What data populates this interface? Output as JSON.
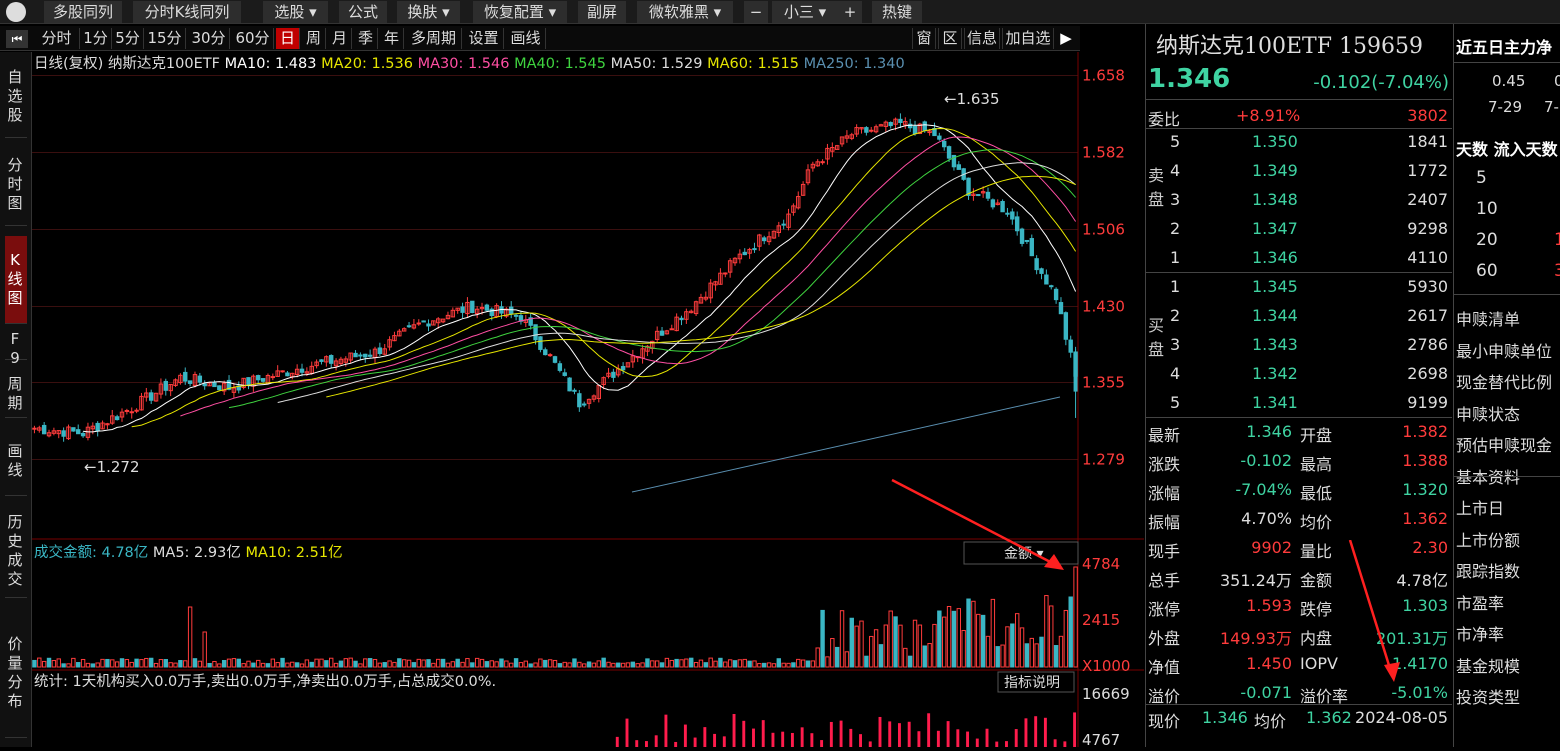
{
  "topbar": [
    "多股同列",
    "分时K线同列",
    "选股",
    "公式",
    "换肤",
    "恢复配置",
    "副屏",
    "微软雅黑",
    "−",
    "小三",
    "+",
    "热键"
  ],
  "periods": [
    "分时",
    "1分",
    "5分",
    "15分",
    "30分",
    "60分",
    "日",
    "周",
    "月",
    "季",
    "年",
    "多周期",
    "设置",
    "画线"
  ],
  "right_tools": [
    "窗",
    "区",
    "信息",
    "加自选"
  ],
  "sidebar": [
    "自选股",
    "分时图",
    "K线图",
    "F9",
    "周期",
    "画线",
    "历史成交",
    "价量分布"
  ],
  "legend": {
    "prefix": "日线(复权)",
    "name": "纳斯达克100ETF",
    "ma": [
      {
        "label": "MA10: 1.483",
        "color": "#ffffff"
      },
      {
        "label": "MA20: 1.536",
        "color": "#e6e600"
      },
      {
        "label": "MA30: 1.546",
        "color": "#ff4fa3"
      },
      {
        "label": "MA40: 1.545",
        "color": "#3fd33f"
      },
      {
        "label": "MA50: 1.529",
        "color": "#dddddd"
      },
      {
        "label": "MA60: 1.515",
        "color": "#e6e600"
      },
      {
        "label": "MA250: 1.340",
        "color": "#5a8fb0"
      }
    ]
  },
  "price_axis": [
    "1.658",
    "1.582",
    "1.506",
    "1.430",
    "1.355",
    "1.279"
  ],
  "annotations": {
    "high": "1.635",
    "low": "1.272"
  },
  "volume": {
    "legend_title": "成交金额: 4.78亿",
    "ma5": "MA5: 2.93亿",
    "ma10": "MA10: 2.51亿",
    "selector": "金额",
    "axis": [
      "4784",
      "2415",
      "X1000"
    ]
  },
  "stats": {
    "text": "统计: 1天机构买入0.0万手,卖出0.0万手,净卖出0.0万手,占总成交0.0%.",
    "button": "指标说明",
    "axis": [
      "16669",
      "4767"
    ]
  },
  "quote": {
    "title": "纳斯达克100ETF 159659",
    "price": "1.346",
    "change": "-0.102(-7.04%)",
    "weibi_label": "委比",
    "weibi": "+8.91%",
    "weicha": "3802",
    "sell_label": "卖盘",
    "buy_label": "买盘",
    "asks": [
      [
        "5",
        "1.350",
        "1841"
      ],
      [
        "4",
        "1.349",
        "1772"
      ],
      [
        "3",
        "1.348",
        "2407"
      ],
      [
        "2",
        "1.347",
        "9298"
      ],
      [
        "1",
        "1.346",
        "4110"
      ]
    ],
    "bids": [
      [
        "1",
        "1.345",
        "5930"
      ],
      [
        "2",
        "1.344",
        "2617"
      ],
      [
        "3",
        "1.343",
        "2786"
      ],
      [
        "4",
        "1.342",
        "2698"
      ],
      [
        "5",
        "1.341",
        "9199"
      ]
    ],
    "stats": [
      [
        "最新",
        "1.346",
        "开盘",
        "1.382"
      ],
      [
        "涨跌",
        "-0.102",
        "最高",
        "1.388"
      ],
      [
        "涨幅",
        "-7.04%",
        "最低",
        "1.320"
      ],
      [
        "振幅",
        "4.70%",
        "均价",
        "1.362"
      ],
      [
        "现手",
        "9902",
        "量比",
        "2.30"
      ],
      [
        "总手",
        "351.24万",
        "金额",
        "4.78亿"
      ],
      [
        "涨停",
        "1.593",
        "跌停",
        "1.303"
      ],
      [
        "外盘",
        "149.93万",
        "内盘",
        "201.31万"
      ],
      [
        "净值",
        "1.450",
        "IOPV",
        "1.4170"
      ],
      [
        "溢价",
        "-0.071",
        "溢价率",
        "-5.01%"
      ]
    ],
    "footer": [
      "现价",
      "1.346",
      "均价",
      "1.362",
      "2024-08-05"
    ]
  },
  "far": {
    "title": "近五日主力净",
    "cols": [
      "0.45",
      "0"
    ],
    "dates": [
      "7-29",
      "7-"
    ],
    "head": [
      "天数",
      "流入天数"
    ],
    "days": [
      "5",
      "10",
      "20",
      "60"
    ],
    "vals": [
      "",
      "",
      "1",
      "3"
    ],
    "items": [
      "申赎清单",
      "最小申赎单位",
      "现金替代比例",
      "申赎状态",
      "预估申赎现金",
      "基本资料",
      "上市日",
      "上市份额",
      "跟踪指数",
      "市盈率",
      "市净率",
      "基金规模",
      "投资类型"
    ]
  },
  "chart_data": {
    "type": "candlestick",
    "price_ticks": [
      1.658,
      1.582,
      1.506,
      1.43,
      1.355,
      1.279
    ],
    "high": 1.635,
    "low": 1.272,
    "last": {
      "open": 1.382,
      "high": 1.388,
      "low": 1.32,
      "close": 1.346
    },
    "ma250_last": 1.34,
    "volume_last": 4784
  }
}
